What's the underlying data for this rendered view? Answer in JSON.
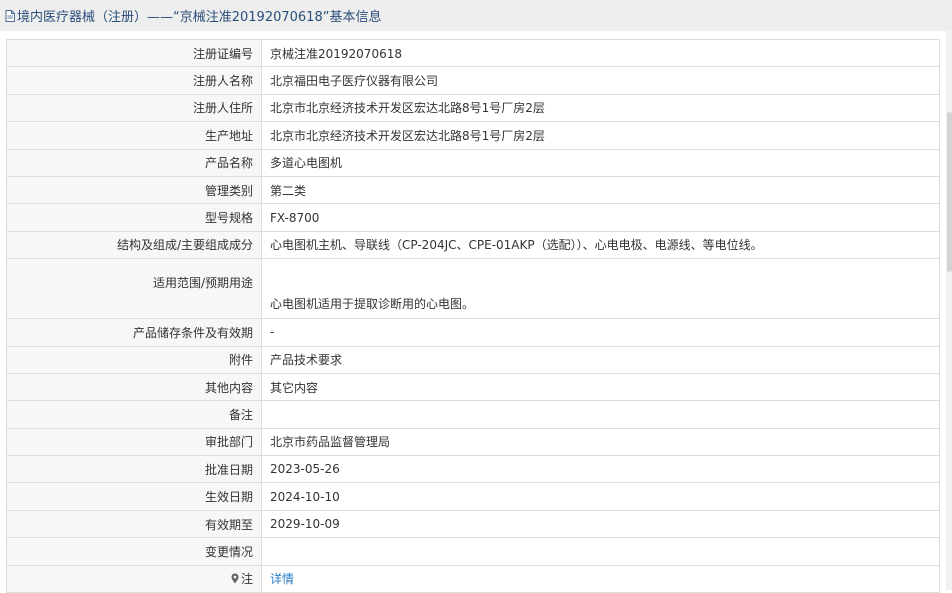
{
  "header": {
    "icon": "document-icon",
    "title": "境内医疗器械（注册）——“京械注准20192070618”基本信息"
  },
  "rows": [
    {
      "label": "注册证编号",
      "value": "京械注准20192070618"
    },
    {
      "label": "注册人名称",
      "value": "北京福田电子医疗仪器有限公司"
    },
    {
      "label": "注册人住所",
      "value": "北京市北京经济技术开发区宏达北路8号1号厂房2层"
    },
    {
      "label": "生产地址",
      "value": "北京市北京经济技术开发区宏达北路8号1号厂房2层"
    },
    {
      "label": "产品名称",
      "value": "多道心电图机"
    },
    {
      "label": "管理类别",
      "value": "第二类"
    },
    {
      "label": "型号规格",
      "value": "FX-8700"
    },
    {
      "label": "结构及组成/主要组成成分",
      "value": "心电图机主机、导联线（CP-204JC、CPE-01AKP（选配））、心电电极、电源线、等电位线。"
    },
    {
      "label": "适用范围/预期用途",
      "value": "心电图机适用于提取诊断用的心电图。"
    },
    {
      "label": "产品储存条件及有效期",
      "value": "-"
    },
    {
      "label": "附件",
      "value": "产品技术要求"
    },
    {
      "label": "其他内容",
      "value": "其它内容"
    },
    {
      "label": "备注",
      "value": ""
    },
    {
      "label": "审批部门",
      "value": "北京市药品监督管理局"
    },
    {
      "label": "批准日期",
      "value": "2023-05-26"
    },
    {
      "label": "生效日期",
      "value": "2024-10-10"
    },
    {
      "label": "有效期至",
      "value": "2029-10-09"
    },
    {
      "label": "变更情况",
      "value": ""
    }
  ],
  "note_row": {
    "icon": "map-pin-icon",
    "label": "注",
    "link": "详情"
  },
  "colors": {
    "header_bg": "#eeeeee",
    "title_text": "#2a4d7a",
    "label_bg": "#f7f7f7",
    "border": "#dddddd",
    "link": "#2a7fc9"
  }
}
